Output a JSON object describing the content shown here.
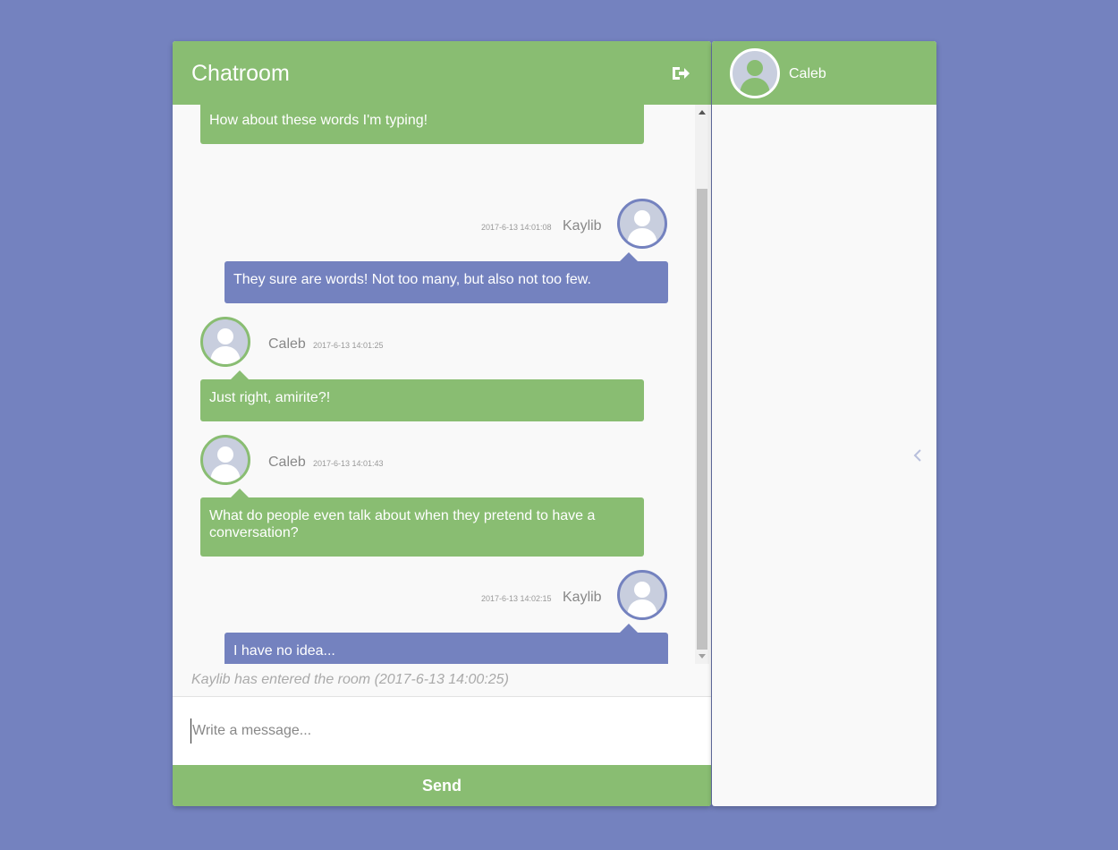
{
  "chat": {
    "title": "Chatroom",
    "logout_icon": "logout-icon"
  },
  "messages": [
    {
      "name": "",
      "time": "",
      "text": "How about these words I'm typing!",
      "color": "green"
    },
    {
      "name": "Kaylib",
      "time": "2017-6-13 14:01:08",
      "text": "They sure are words! Not too many, but also not too few.",
      "color": "blue"
    },
    {
      "name": "Caleb",
      "time": "2017-6-13 14:01:25",
      "text": "Just right, amirite?!",
      "color": "green"
    },
    {
      "name": "Caleb",
      "time": "2017-6-13 14:01:43",
      "text": "What do people even talk about when they pretend to have a conversation?",
      "color": "green"
    },
    {
      "name": "Kaylib",
      "time": "2017-6-13 14:02:15",
      "text": "I have no idea...",
      "color": "blue"
    }
  ],
  "system_message": "Kaylib has entered the room (2017-6-13 14:00:25)",
  "input": {
    "placeholder": "Write a message...",
    "value": ""
  },
  "send_label": "Send",
  "users": [
    {
      "name": "Caleb"
    }
  ],
  "colors": {
    "background": "#7482bf",
    "green": "#89bd72",
    "blue": "#7482bf",
    "panel": "#f9f9f9"
  }
}
